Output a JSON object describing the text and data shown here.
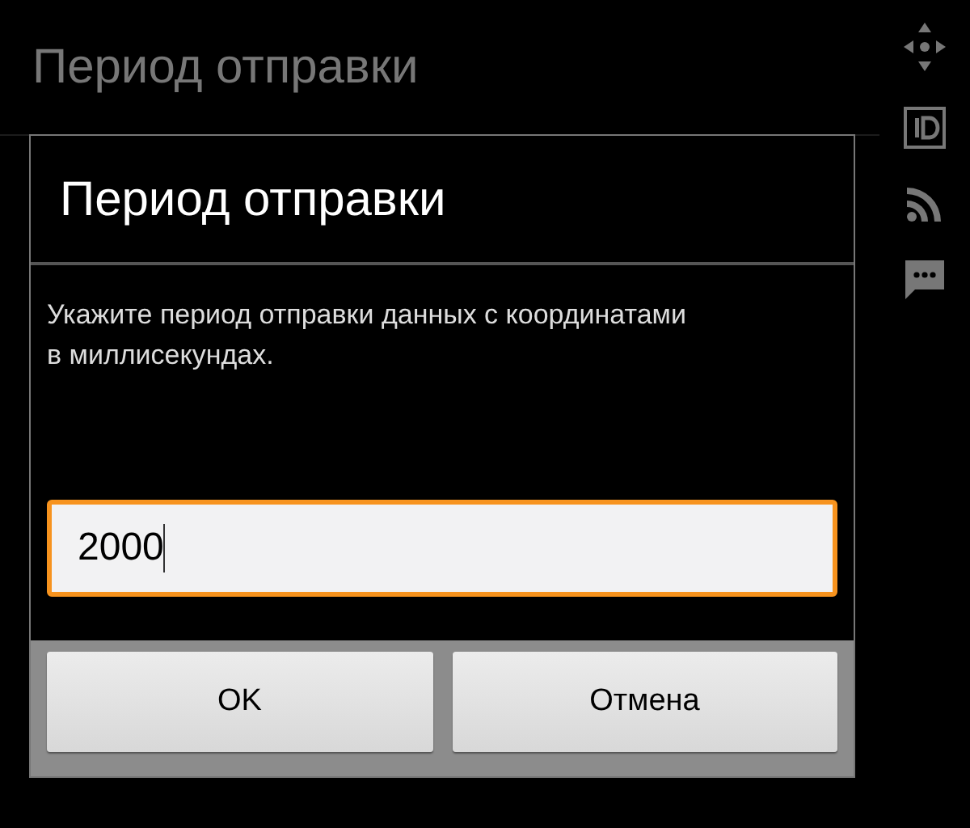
{
  "screen": {
    "title": "Период отправки"
  },
  "dialog": {
    "title": "Период отправки",
    "message": "Укажите период отправки данных с координатами в миллисекундах.",
    "input": {
      "value": "2000",
      "focused": true
    },
    "buttons": [
      {
        "label": "OK"
      },
      {
        "label": "Отмена"
      }
    ]
  }
}
